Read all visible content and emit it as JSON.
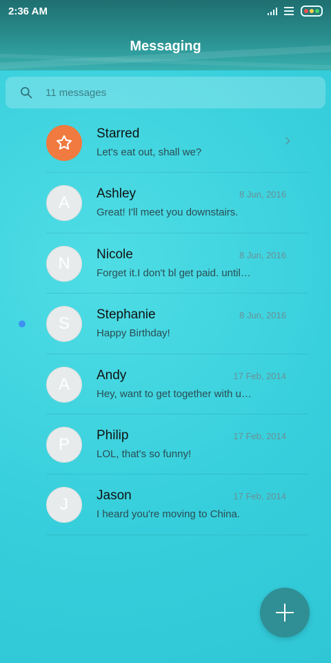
{
  "status_bar": {
    "time": "2:36 AM"
  },
  "header": {
    "title": "Messaging"
  },
  "search": {
    "placeholder": "11 messages"
  },
  "conversations": [
    {
      "name": "Starred",
      "preview": "Let's eat out, shall we?",
      "date": "",
      "avatar_letter": ""
    },
    {
      "name": "Ashley",
      "preview": "Great! I'll meet you downstairs.",
      "date": "8 Jun, 2016",
      "avatar_letter": "A"
    },
    {
      "name": "Nicole",
      "preview": "Forget it.I don't bl get paid. until next week.",
      "date": "8 Jun, 2016",
      "avatar_letter": "N"
    },
    {
      "name": "Stephanie",
      "preview": "Happy Birthday!",
      "date": "8 Jun, 2016",
      "avatar_letter": "S"
    },
    {
      "name": "Andy",
      "preview": "Hey, want to get together with us tonight?",
      "date": "17 Feb, 2014",
      "avatar_letter": "A"
    },
    {
      "name": "Philip",
      "preview": "LOL, that's so funny!",
      "date": "17 Feb, 2014",
      "avatar_letter": "P"
    },
    {
      "name": "Jason",
      "preview": "I heard you're moving to China.",
      "date": "17 Feb, 2014",
      "avatar_letter": "J"
    }
  ],
  "colors": {
    "starred_accent": "#f07a3f",
    "unread_dot": "#3d8ff0",
    "fab": "#2f8f94",
    "battery_dot_1": "#ff4d4d",
    "battery_dot_2": "#ffd24d",
    "battery_dot_3": "#4dd26a"
  },
  "icons": {
    "search": "search-icon",
    "starred": "star-icon",
    "chevron": "chevron-right-icon",
    "compose": "plus-icon"
  }
}
